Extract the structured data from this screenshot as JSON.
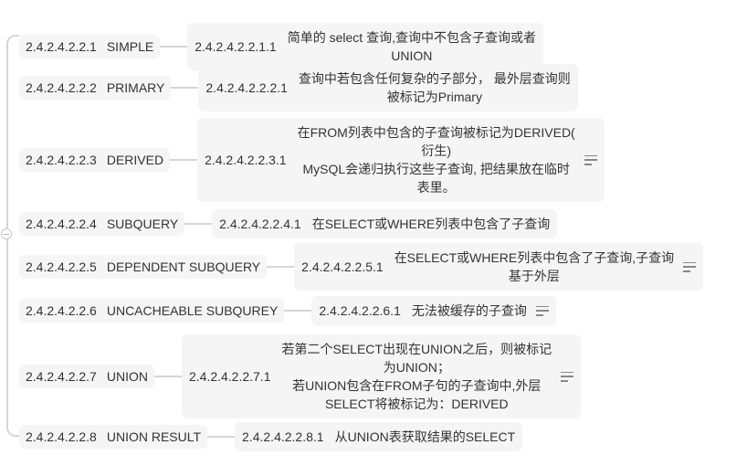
{
  "items": [
    {
      "num": "2.4.2.4.2.2.1",
      "name": "SIMPLE",
      "child_num": "2.4.2.4.2.2.1.1",
      "child_lines": [
        "简单的 select 查询,查询中不包含子查询或者",
        "UNION"
      ]
    },
    {
      "num": "2.4.2.4.2.2.2",
      "name": "PRIMARY",
      "child_num": "2.4.2.4.2.2.2.1",
      "child_lines": [
        "查询中若包含任何复杂的子部分， 最外层查询则",
        "被标记为Primary"
      ]
    },
    {
      "num": "2.4.2.4.2.2.3",
      "name": "DERIVED",
      "child_num": "2.4.2.4.2.2.3.1",
      "child_lines": [
        "在FROM列表中包含的子查询被标记为DERIVED(",
        "衍生)",
        "MySQL会递归执行这些子查询, 把结果放在临时",
        "表里。"
      ]
    },
    {
      "num": "2.4.2.4.2.2.4",
      "name": "SUBQUERY",
      "child_num": "2.4.2.4.2.2.4.1",
      "child_lines": [
        "在SELECT或WHERE列表中包含了子查询"
      ]
    },
    {
      "num": "2.4.2.4.2.2.5",
      "name": "DEPENDENT SUBQUERY",
      "child_num": "2.4.2.4.2.2.5.1",
      "child_lines": [
        "在SELECT或WHERE列表中包含了子查询,子查询",
        "基于外层"
      ]
    },
    {
      "num": "2.4.2.4.2.2.6",
      "name": "UNCACHEABLE SUBQUREY",
      "child_num": "2.4.2.4.2.2.6.1",
      "child_lines": [
        "无法被缓存的子查询"
      ]
    },
    {
      "num": "2.4.2.4.2.2.7",
      "name": "UNION",
      "child_num": "2.4.2.4.2.2.7.1",
      "child_lines": [
        "若第二个SELECT出现在UNION之后，则被标记",
        "为UNION；",
        "若UNION包含在FROM子句的子查询中,外层",
        "SELECT将被标记为：DERIVED"
      ]
    },
    {
      "num": "2.4.2.4.2.2.8",
      "name": "UNION RESULT",
      "child_num": "2.4.2.4.2.2.8.1",
      "child_lines": [
        "从UNION表获取结果的SELECT"
      ]
    }
  ],
  "note_icons": [
    false,
    false,
    true,
    false,
    true,
    true,
    true,
    false
  ]
}
